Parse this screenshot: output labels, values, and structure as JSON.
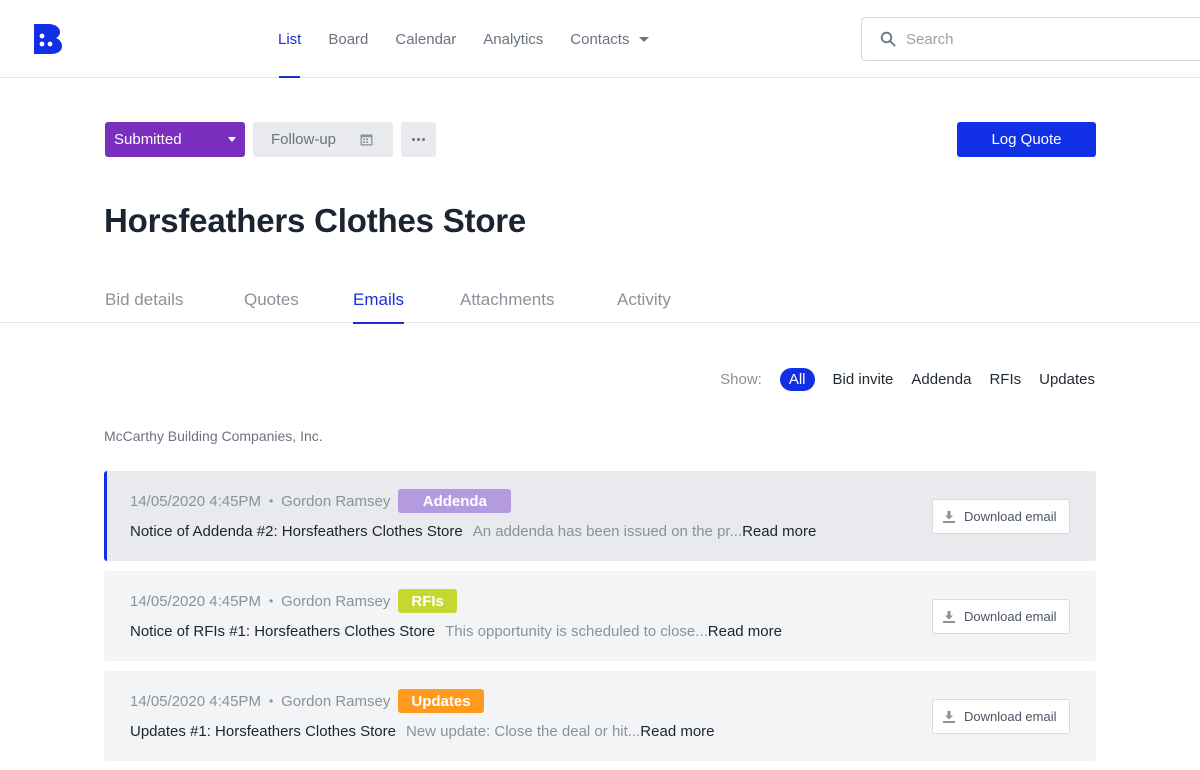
{
  "nav": {
    "items": [
      {
        "label": "List",
        "active": true
      },
      {
        "label": "Board",
        "active": false
      },
      {
        "label": "Calendar",
        "active": false
      },
      {
        "label": "Analytics",
        "active": false
      },
      {
        "label": "Contacts",
        "active": false
      }
    ]
  },
  "search": {
    "placeholder": "Search",
    "value": ""
  },
  "actions": {
    "status_label": "Submitted",
    "followup_label": "Follow-up",
    "log_quote_label": "Log Quote"
  },
  "page": {
    "title": "Horsfeathers Clothes Store"
  },
  "tabs": [
    {
      "label": "Bid details"
    },
    {
      "label": "Quotes"
    },
    {
      "label": "Emails",
      "active": true
    },
    {
      "label": "Attachments"
    },
    {
      "label": "Activity"
    }
  ],
  "filters": {
    "label": "Show:",
    "chips": [
      "All",
      "Bid invite",
      "Addenda",
      "RFIs",
      "Updates"
    ],
    "active": "All"
  },
  "company": "McCarthy Building Companies, Inc.",
  "emails": [
    {
      "date": "14/05/2020 4:45PM",
      "sender": "Gordon Ramsey",
      "badge": "Addenda",
      "badge_color": "#b49be0",
      "subject": "Notice of Addenda #2: Horsfeathers Clothes Store",
      "preview": "An addenda has been issued on the pr...",
      "read_more": "Read more",
      "download_label": "Download email"
    },
    {
      "date": "14/05/2020 4:45PM",
      "sender": "Gordon Ramsey",
      "badge": "RFIs",
      "badge_color": "#c6d82f",
      "subject": "Notice of RFIs #1: Horsfeathers Clothes Store",
      "preview": "This opportunity is scheduled to close...",
      "read_more": "Read more",
      "download_label": "Download email"
    },
    {
      "date": "14/05/2020 4:45PM",
      "sender": "Gordon Ramsey",
      "badge": "Updates",
      "badge_color": "#ff9a1f",
      "subject": "Updates #1: Horsfeathers Clothes Store",
      "preview": "New update: Close the deal or hit...",
      "read_more": "Read more",
      "download_label": "Download email"
    }
  ],
  "colors": {
    "accent": "#1130e6",
    "status": "#7b2fbe"
  }
}
